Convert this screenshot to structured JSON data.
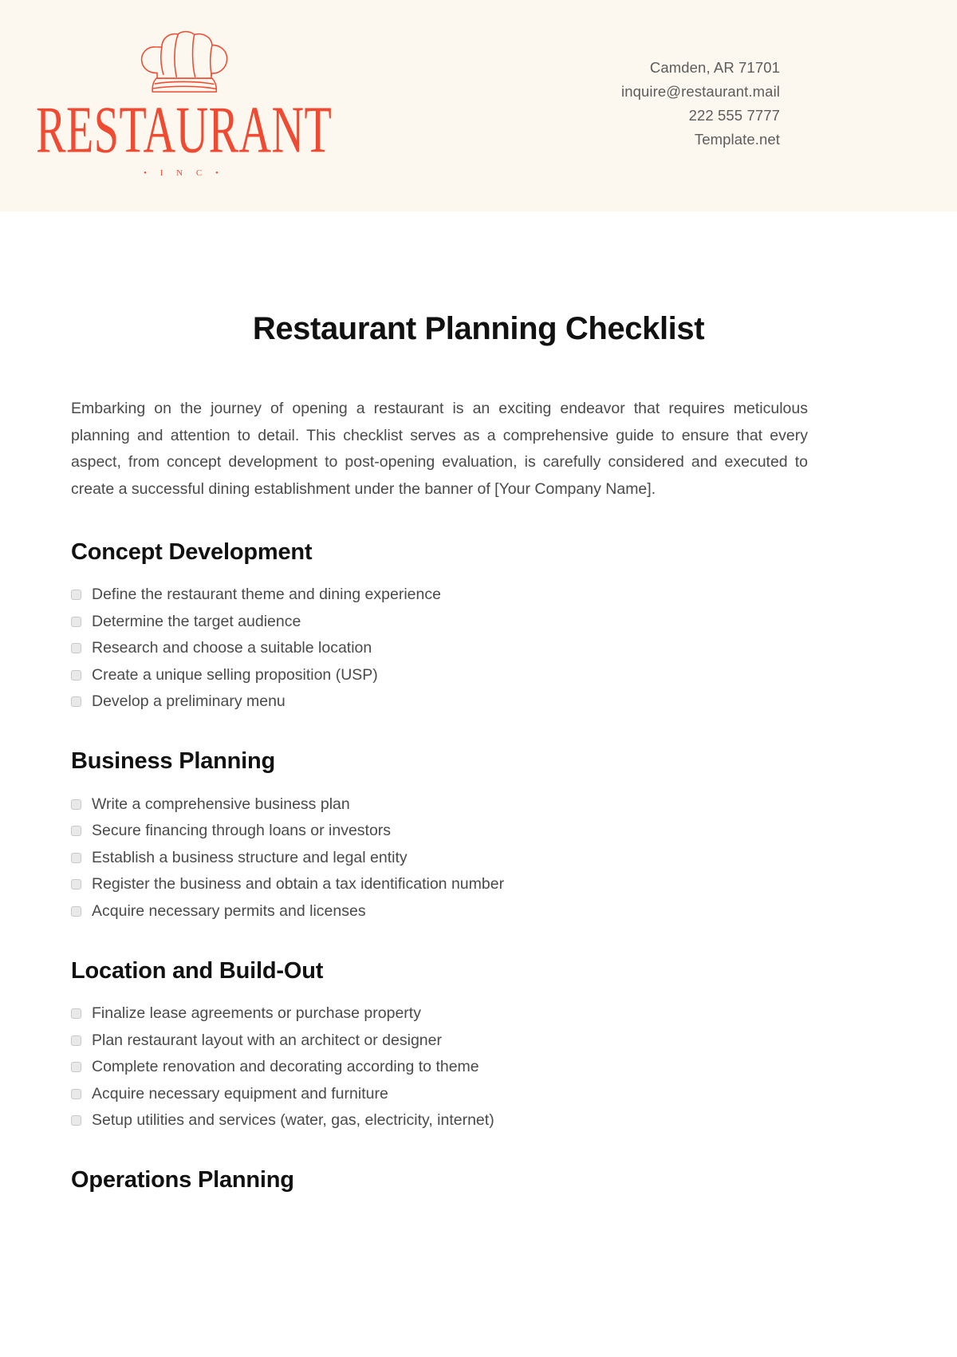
{
  "header": {
    "logo": {
      "icon": "chef-hat-icon",
      "wordmark": "RESTAURANT",
      "sub": "• I N C •",
      "color": "#ef4a32"
    },
    "contact": [
      "Camden, AR 71701",
      "inquire@restaurant.mail",
      "222 555 7777",
      "Template.net"
    ],
    "background_color": "#fdf8ef"
  },
  "document": {
    "title": "Restaurant Planning Checklist",
    "intro": "Embarking on the journey of opening a restaurant is an exciting endeavor that requires meticulous planning and attention to detail. This checklist serves as a comprehensive guide to ensure that every aspect, from concept development to post-opening evaluation, is carefully considered and executed to create a successful dining establishment under the banner of [Your Company Name].",
    "sections": [
      {
        "title": "Concept Development",
        "items": [
          "Define the restaurant theme and dining experience",
          "Determine the target audience",
          "Research and choose a suitable location",
          "Create a unique selling proposition (USP)",
          "Develop a preliminary menu"
        ]
      },
      {
        "title": "Business Planning",
        "items": [
          "Write a comprehensive business plan",
          "Secure financing through loans or investors",
          "Establish a business structure and legal entity",
          "Register the business and obtain a tax identification number",
          "Acquire necessary permits and licenses"
        ]
      },
      {
        "title": "Location and Build-Out",
        "items": [
          "Finalize lease agreements or purchase property",
          "Plan restaurant layout with an architect or designer",
          "Complete renovation and decorating according to theme",
          "Acquire necessary equipment and furniture",
          "Setup utilities and services (water, gas, electricity, internet)"
        ]
      },
      {
        "title": "Operations Planning",
        "items": []
      }
    ]
  }
}
